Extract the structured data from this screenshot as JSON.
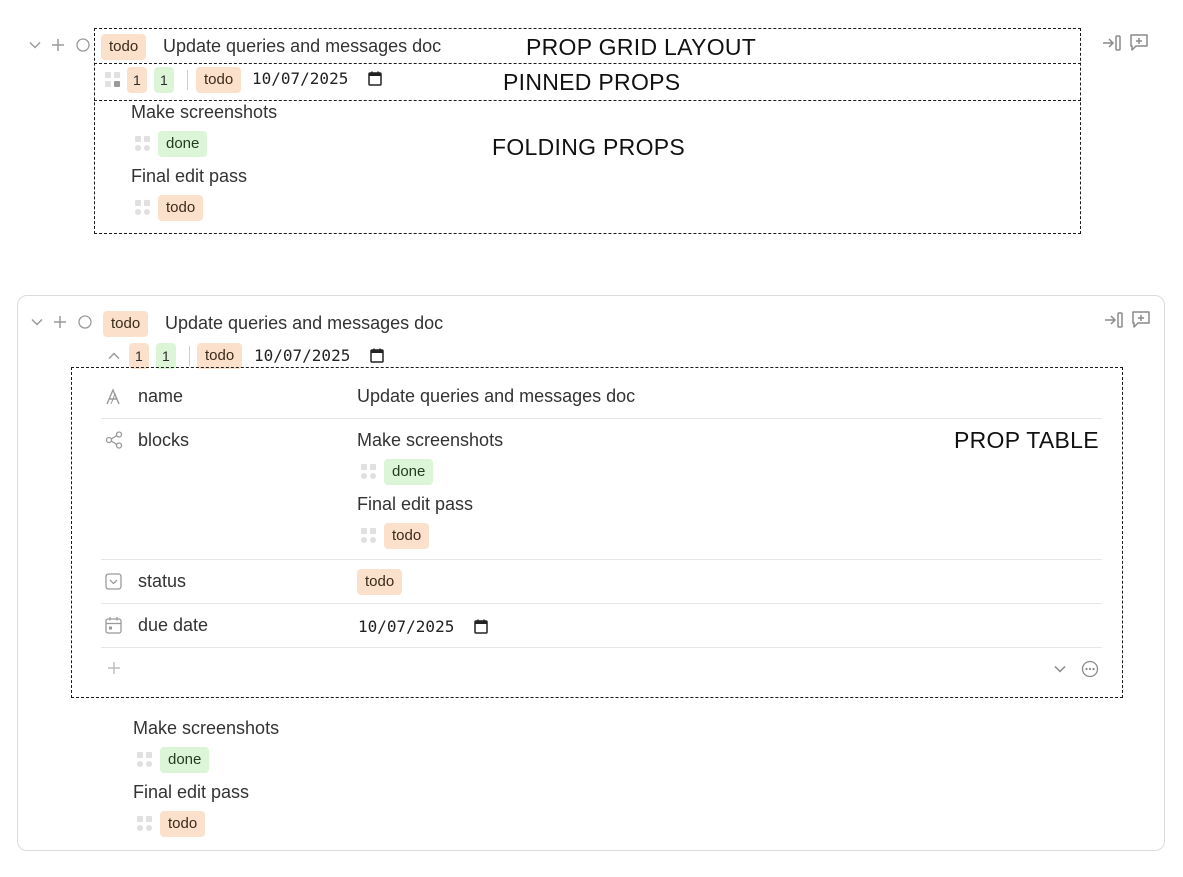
{
  "annotations": {
    "grid_layout": "PROP GRID LAYOUT",
    "pinned_props": "PINNED PROPS",
    "folding_props": "FOLDING PROPS",
    "prop_table": "PROP TABLE"
  },
  "block1": {
    "status_chip": "todo",
    "title": "Update queries and messages doc",
    "pinned": {
      "count_a": "1",
      "count_b": "1",
      "status": "todo",
      "due_date": "10/07/2025"
    },
    "children": [
      {
        "title": "Make screenshots",
        "status": "done"
      },
      {
        "title": "Final edit pass",
        "status": "todo"
      }
    ]
  },
  "block2": {
    "status_chip": "todo",
    "title": "Update queries and messages doc",
    "pinned": {
      "count_a": "1",
      "count_b": "1",
      "status": "todo",
      "due_date": "10/07/2025"
    },
    "table": {
      "name_label": "name",
      "name_value": "Update queries and messages doc",
      "blocks_label": "blocks",
      "blocks": [
        {
          "title": "Make screenshots",
          "status": "done"
        },
        {
          "title": "Final edit pass",
          "status": "todo"
        }
      ],
      "status_label": "status",
      "status_value": "todo",
      "due_label": "due date",
      "due_value": "10/07/2025"
    },
    "children": [
      {
        "title": "Make screenshots",
        "status": "done"
      },
      {
        "title": "Final edit pass",
        "status": "todo"
      }
    ]
  },
  "colors": {
    "todo_bg": "#fbe1cc",
    "done_bg": "#dcf5d6",
    "icon_gray": "#9a9a9a"
  },
  "icons": [
    "chevron-down-icon",
    "plus-icon",
    "circle-icon",
    "sidebar-open-icon",
    "add-comment-icon",
    "drag-handle-icon",
    "calendar-icon",
    "text-icon",
    "relation-icon",
    "select-icon",
    "more-icon",
    "chevron-up-icon"
  ]
}
